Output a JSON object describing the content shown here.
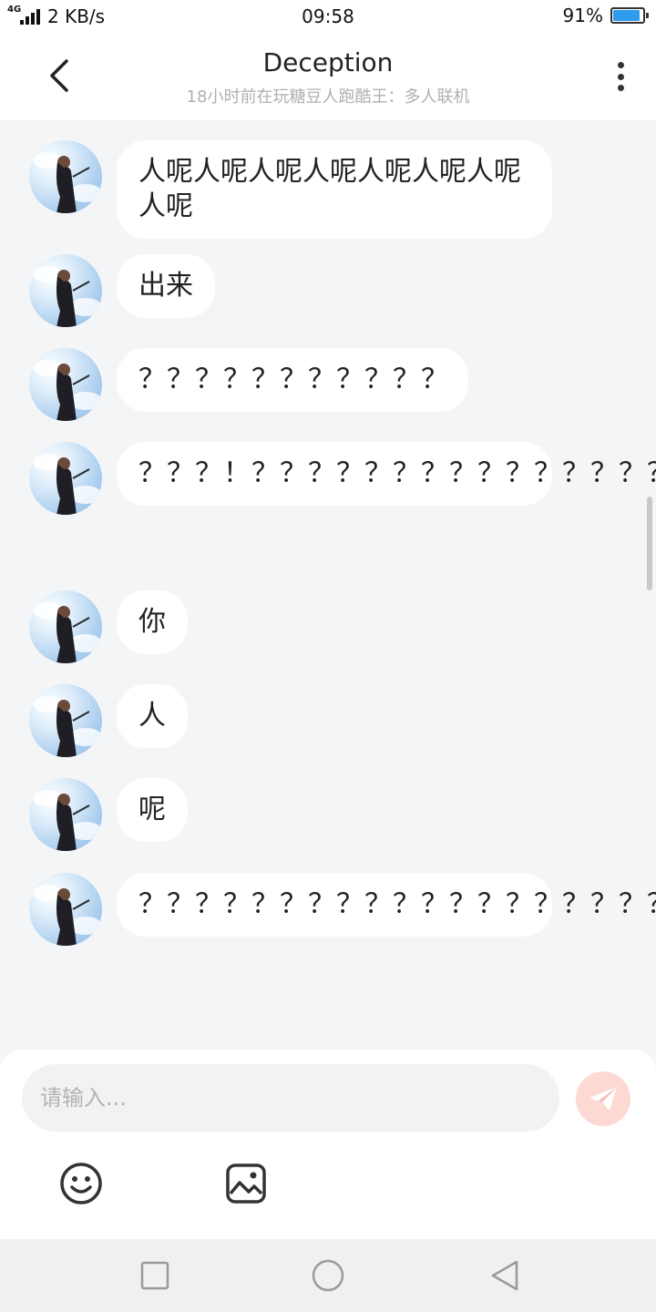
{
  "status_bar": {
    "network_type": "4G",
    "speed": "2 KB/s",
    "time": "09:58",
    "battery": "91%",
    "battery_level": 0.91
  },
  "header": {
    "title": "Deception",
    "subtitle": "18小时前在玩糖豆人跑酷王：多人联机"
  },
  "messages": [
    {
      "text": "人呢人呢人呢人呢人呢人呢人呢人呢"
    },
    {
      "text": "出来"
    },
    {
      "text": "？？？？？？？？？？？"
    },
    {
      "text": "？？？！？？？？？？？？？？？？？？？？？？？？？？？？？？？？？？？？？？？"
    },
    {
      "text": "你"
    },
    {
      "text": "人"
    },
    {
      "text": "呢"
    },
    {
      "text": "？？？？？？？？？？？？？？？？？？？？？？？？？？？？？？？？？？？？？？？？？？？？？？？？？？？？？？？？？？？？？？？？？？？？？？？？？？"
    }
  ],
  "composer": {
    "placeholder": "请输入..."
  },
  "colors": {
    "accent": "#2f9cf0",
    "send_button": "#fdd9d4",
    "background": "#f4f5f7"
  },
  "icons": {
    "back": "back-arrow-icon",
    "more": "more-vertical-icon",
    "send": "paper-plane-icon",
    "emoji": "smiley-icon",
    "image": "image-icon",
    "recents": "square-icon",
    "home": "circle-icon",
    "nav_back": "triangle-back-icon"
  }
}
